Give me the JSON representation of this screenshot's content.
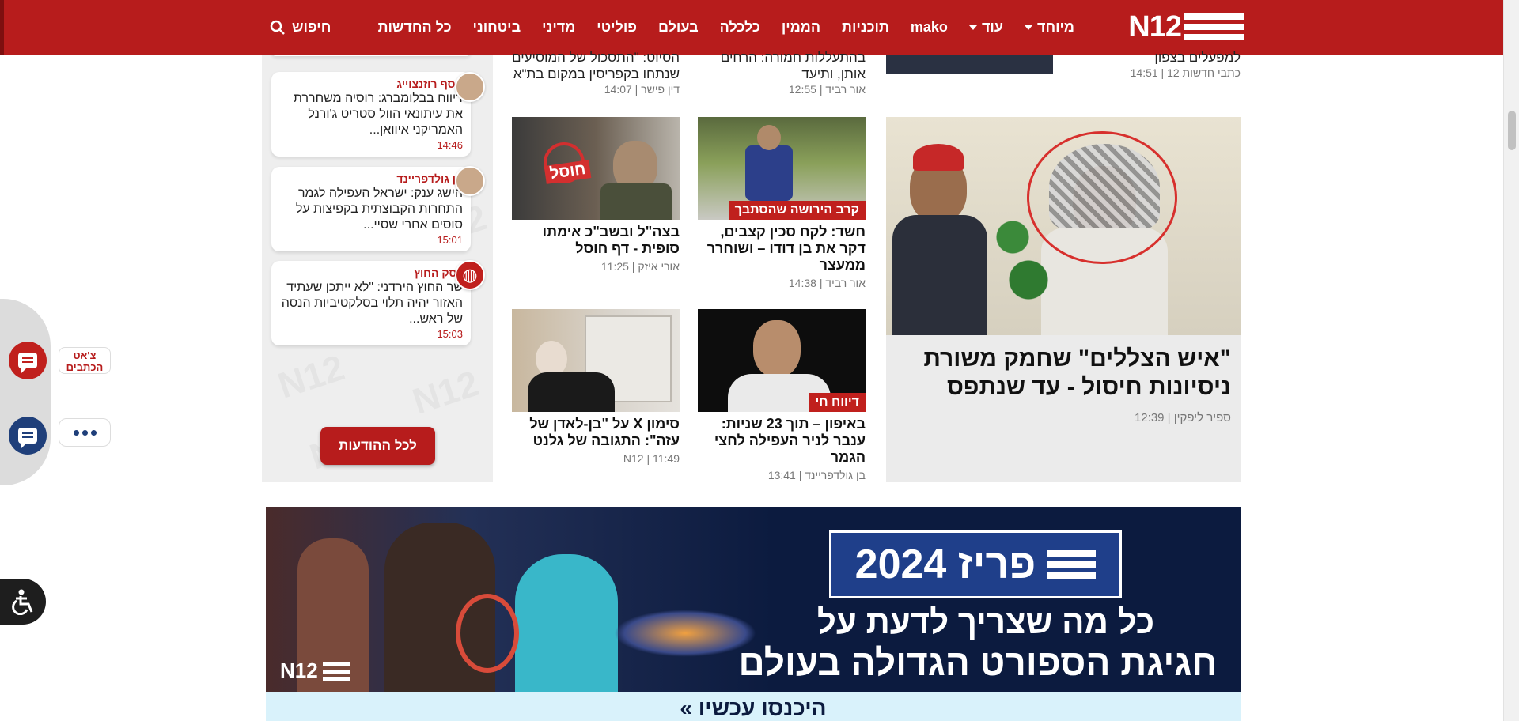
{
  "header": {
    "logo_text": "N12",
    "nav": [
      {
        "label": "כל החדשות",
        "dropdown": false
      },
      {
        "label": "ביטחוני",
        "dropdown": false
      },
      {
        "label": "מדיני",
        "dropdown": false
      },
      {
        "label": "פוליטי",
        "dropdown": false
      },
      {
        "label": "בעולם",
        "dropdown": false
      },
      {
        "label": "כלכלה",
        "dropdown": false
      },
      {
        "label": "הממין",
        "dropdown": false
      },
      {
        "label": "תוכניות",
        "dropdown": false
      },
      {
        "label": "mako",
        "dropdown": false
      },
      {
        "label": "עוד",
        "dropdown": true
      },
      {
        "label": "מיוחד",
        "dropdown": true
      }
    ],
    "search_label": "חיפוש",
    "bg_color": "#b71c1c"
  },
  "side_widgets": {
    "chat_label": "צ'אט הכתבים",
    "accessibility_icon": "accessibility-icon"
  },
  "updates": {
    "items": [
      {
        "author": "אסף רוזנצוייג",
        "text": "דיווח בבלומברג: רוסיה משחררת את עיתונאי הוול סטריט ג'ורנל האמריקני איוואן...",
        "time": "14:46"
      },
      {
        "author": "בן גולדפריינד",
        "text": "הישג ענק: ישראל העפילה לגמר התחרות הקבוצתית בקפיצות על סוסים אחרי שסיי...",
        "time": "15:01"
      },
      {
        "author": "דסק החוץ",
        "text": "שר החוץ הירדני: \"לא ייתכן שעתיד האזור יהיה תלוי בסלקטיביות הנסה של ראש...",
        "time": "15:03"
      }
    ],
    "all_label": "לכל ההודעות"
  },
  "top_partials": [
    {
      "title": "הסיוט: \"התסכול של המוסיעים שנתחו בקפריסין במקום בת\"א",
      "author": "דין פישר",
      "time": "14:07"
    },
    {
      "title": "בהתעללות חמורה: הרחים אותן, ותיעד",
      "author": "אור רביד",
      "time": "12:55"
    },
    {
      "title": "למפעלים בצפון",
      "author": "כתבי חדשות 12",
      "time": "14:51"
    }
  ],
  "articles": [
    {
      "title": "חשד: לקח סכין קצבים, דקר את בן דודו – ושוחרר ממעצר",
      "tag": "קרב הירושה שהסתבך",
      "author": "אור רביד",
      "time": "14:38"
    },
    {
      "title": "בצה\"ל ובשב\"כ אימתו סופית - דף חוסל",
      "tag": "",
      "thumb_stamp": "חוסל",
      "author": "אורי איזק",
      "time": "11:25"
    },
    {
      "title": "באיפון – תוך 23 שניות: ענבר לניר העפילה לחצי הגמר",
      "tag": "דיווח חי",
      "author": "בן גולדפריינד",
      "time": "13:41"
    },
    {
      "title": "סימון X על \"בן-לאדן של עזה\": התגובה של גלנט",
      "tag": "",
      "author": "N12",
      "time": "11:49"
    }
  ],
  "feature": {
    "title": "\"איש הצללים\" שחמק משורת ניסיונות חיסול - עד שנתפס",
    "author": "ספיר ליפקין",
    "time": "12:39"
  },
  "banner": {
    "logo_text": "פריז 2024",
    "line1": "כל מה שצריך לדעת על",
    "line2": "חגיגת הספורט הגדולה בעולם",
    "brand": "N12",
    "cta": "היכנסו עכשיו »"
  }
}
